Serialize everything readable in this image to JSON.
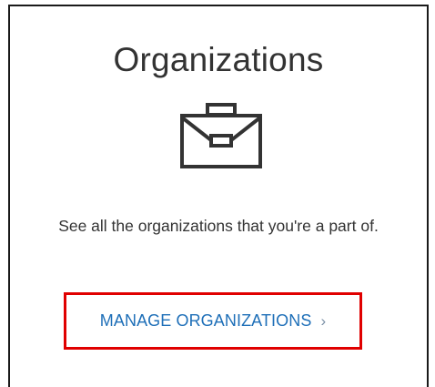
{
  "card": {
    "title": "Organizations",
    "icon": "briefcase-icon",
    "description": "See all the organizations that you're a part of.",
    "manage_link_label": "MANAGE ORGANIZATIONS",
    "chevron": "›"
  },
  "colors": {
    "link": "#1e6fb8",
    "highlight": "#e00000",
    "text": "#333333"
  }
}
